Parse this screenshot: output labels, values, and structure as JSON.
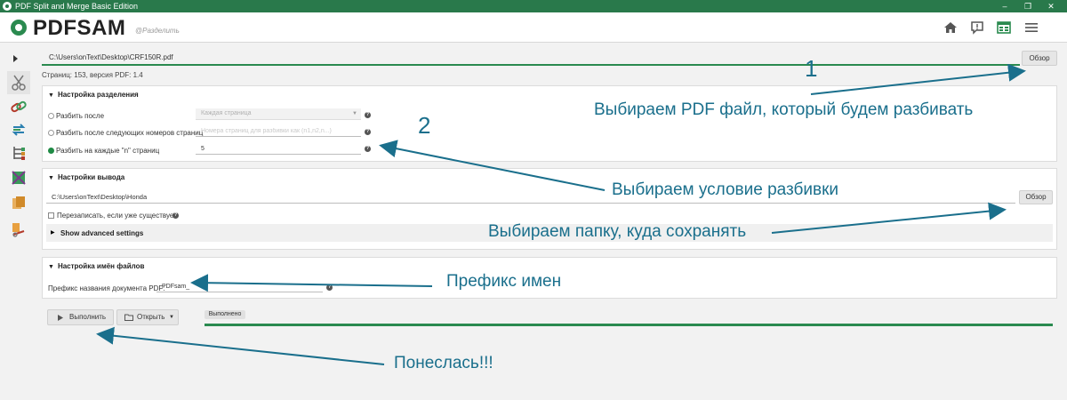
{
  "window": {
    "title": "PDF Split and Merge Basic Edition",
    "minimize": "–",
    "maximize": "❐",
    "close": "✕"
  },
  "header": {
    "logo": "PDFSAM",
    "module": "@Разделить"
  },
  "file": {
    "path": "C:\\Users\\onText\\Desktop\\CRF150R.pdf",
    "browse_label": "Обзор",
    "info": "Страниц: 153, версия PDF: 1.4"
  },
  "split_settings": {
    "title": "Настройка разделения",
    "option_after": "Разбить после",
    "option_after_value": "Каждая страница",
    "option_pages": "Разбить после следующих номеров страниц",
    "option_pages_placeholder": "Номера страниц для разбивки как (n1,n2,n...)",
    "option_every": "Разбить на каждые \"n\" страниц",
    "option_every_value": "5"
  },
  "output_settings": {
    "title": "Настройки вывода",
    "path": "C:\\Users\\onText\\Desktop\\Honda",
    "browse_label": "Обзор",
    "overwrite_label": "Перезаписать, если уже существует",
    "advanced_label": "Show advanced settings"
  },
  "filename_settings": {
    "title": "Настройка имён файлов",
    "prefix_label": "Префикс названия документа PDF:",
    "prefix_value": "PDFsam_"
  },
  "footer": {
    "run_label": "Выполнить",
    "open_label": "Открыть",
    "status": "Выполнено",
    "progress": 1.0
  },
  "annotations": {
    "n1": "1",
    "n2": "2",
    "a1": "Выбираем PDF файл, который будем разбивать",
    "a2": "Выбираем условие разбивки",
    "a3": "Выбираем папку, куда сохранять",
    "a4": "Префикс имен",
    "a5": "Понеслась!!!"
  },
  "colors": {
    "accent": "#2a8a4f",
    "titlebar": "#29794b",
    "annotation": "#1a6f8c"
  },
  "icons": {
    "home": "home-icon",
    "feedback": "feedback-icon",
    "dashboard": "dashboard-icon",
    "menu": "menu-icon"
  }
}
